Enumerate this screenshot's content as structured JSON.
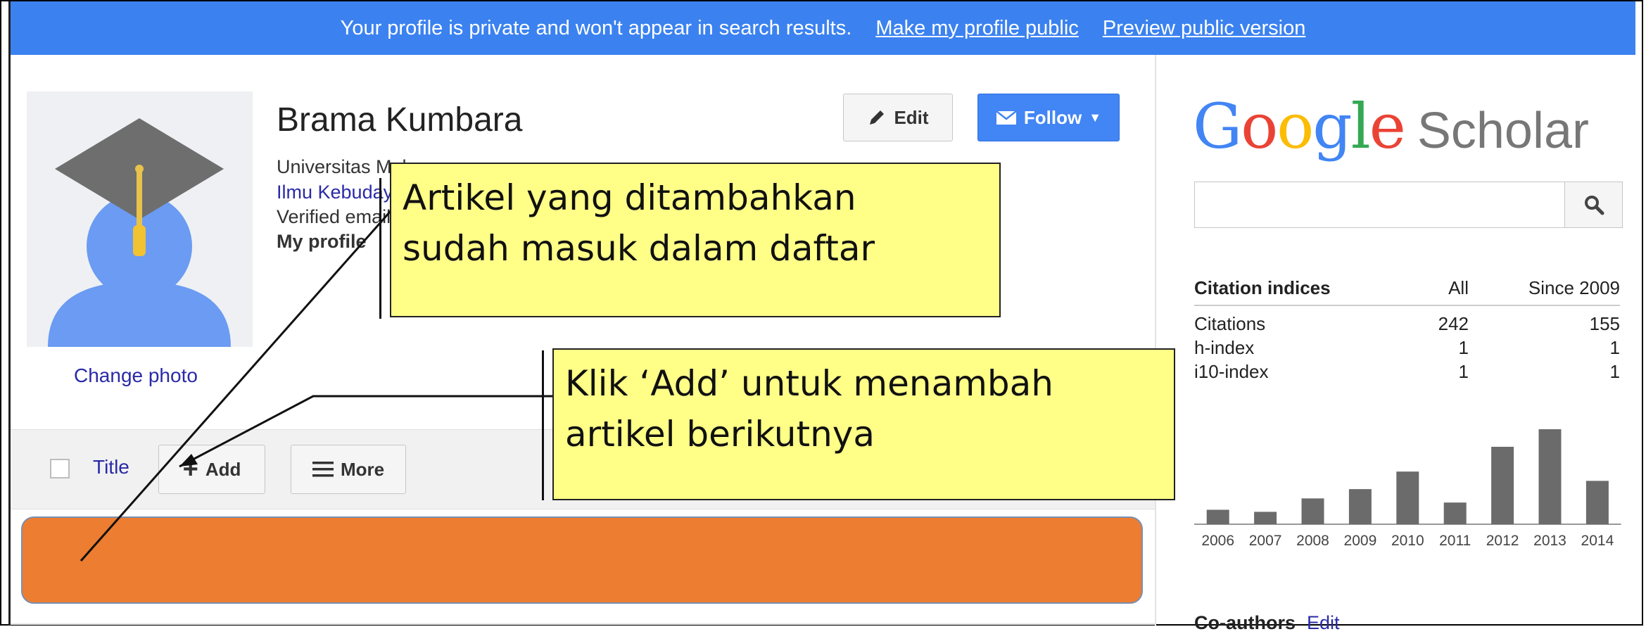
{
  "banner": {
    "message": "Your profile is private and won't appear in search results.",
    "make_public": "Make my profile public",
    "preview": "Preview public version"
  },
  "profile": {
    "name": "Brama Kumbara",
    "affiliation": "Universitas Mulawarman",
    "field": "Ilmu Kebudayaan",
    "verified": "Verified email",
    "my_profile": "My profile",
    "change_photo": "Change photo"
  },
  "buttons": {
    "edit": "Edit",
    "follow": "Follow",
    "add": "Add",
    "more": "More"
  },
  "toolbar": {
    "title": "Title"
  },
  "scholar": {
    "google": "Google",
    "scholar": "Scholar"
  },
  "citations": {
    "header": [
      "Citation indices",
      "All",
      "Since 2009"
    ],
    "rows": [
      {
        "label": "Citations",
        "all": "242",
        "since": "155"
      },
      {
        "label": "h-index",
        "all": "1",
        "since": "1"
      },
      {
        "label": "i10-index",
        "all": "1",
        "since": "1"
      }
    ]
  },
  "chart_data": {
    "type": "bar",
    "categories": [
      "2006",
      "2007",
      "2008",
      "2009",
      "2010",
      "2011",
      "2012",
      "2013",
      "2014"
    ],
    "values": [
      14,
      12,
      25,
      34,
      51,
      21,
      75,
      92,
      42
    ]
  },
  "coauthors": {
    "title": "Co-authors",
    "edit": "Edit"
  },
  "callouts": {
    "first": [
      "Artikel yang ditambahkan",
      "sudah masuk dalam daftar"
    ],
    "second": [
      "Klik ‘Add’ untuk menambah",
      "artikel berikutnya"
    ]
  },
  "colors": {
    "banner": "#3b82f0",
    "follow": "#4285f4",
    "orange": "#ed7d31",
    "callout": "#ffff88",
    "bar": "#6b6b6b"
  },
  "icons": {
    "edit": "pencil-icon",
    "follow": "envelope-icon",
    "add": "plus-icon",
    "more": "hamburger-icon",
    "search": "magnifier-icon"
  }
}
